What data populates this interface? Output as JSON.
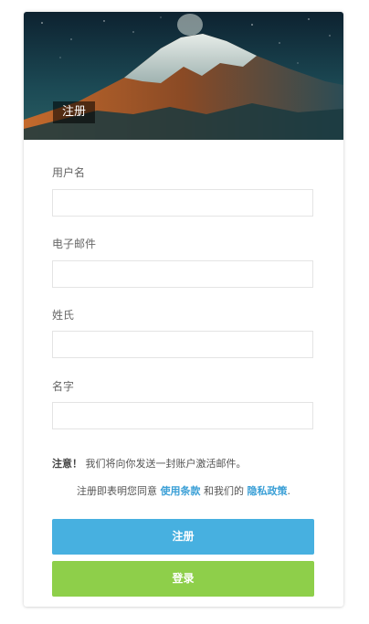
{
  "hero": {
    "title": "注册"
  },
  "form": {
    "fields": [
      {
        "label": "用户名",
        "value": "",
        "placeholder": ""
      },
      {
        "label": "电子邮件",
        "value": "",
        "placeholder": ""
      },
      {
        "label": "姓氏",
        "value": "",
        "placeholder": ""
      },
      {
        "label": "名字",
        "value": "",
        "placeholder": ""
      }
    ],
    "notice": {
      "strong": "注意！",
      "text": "我们将向你发送一封账户激活邮件。"
    },
    "terms": {
      "prefix": "注册即表明您同意",
      "terms_link": "使用条款",
      "middle": "和我们的",
      "privacy_link": "隐私政策",
      "suffix": "."
    },
    "buttons": {
      "register": "注册",
      "login": "登录"
    }
  },
  "colors": {
    "register_button": "#47b0e0",
    "login_button": "#8ecf4a",
    "link": "#3a9fd6"
  }
}
